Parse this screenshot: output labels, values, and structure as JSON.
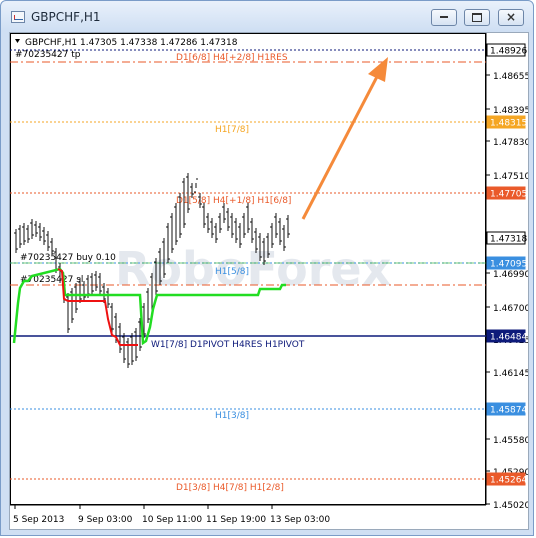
{
  "window": {
    "title": "GBPCHF,H1",
    "controls": [
      "minimize",
      "maximize",
      "close"
    ]
  },
  "chart_header": {
    "symbol_line": "GBPCHF,H1  1.47305 1.47338 1.47286 1.47318",
    "order_tp": "#70235427 tp",
    "order_buy": "#70235427 buy 0.10",
    "order_sl": "#70235427 sl"
  },
  "price_axis": {
    "ticks": [
      "1.48655",
      "1.48395",
      "1.47830",
      "1.47510",
      "1.46990",
      "1.46700",
      "1.46425",
      "1.46145",
      "1.45580",
      "1.45290",
      "1.45020"
    ],
    "tags": [
      {
        "label": "1.48926",
        "color": "#ffffff",
        "fg": "#000000"
      },
      {
        "label": "1.48315",
        "color": "#f5a623",
        "fg": "#ffffff"
      },
      {
        "label": "1.47705",
        "color": "#ea5a2a",
        "fg": "#ffffff"
      },
      {
        "label": "1.47318",
        "color": "#ffffff",
        "fg": "#000000"
      },
      {
        "label": "1.47095",
        "color": "#3a8fe0",
        "fg": "#ffffff"
      },
      {
        "label": "1.46484",
        "color": "#0d1a7a",
        "fg": "#ffffff"
      },
      {
        "label": "1.45874",
        "color": "#3a8fe0",
        "fg": "#ffffff"
      },
      {
        "label": "1.45264",
        "color": "#ea5a2a",
        "fg": "#ffffff"
      }
    ]
  },
  "time_axis": {
    "ticks": [
      "5 Sep 2013",
      "9 Sep 03:00",
      "10 Sep 11:00",
      "11 Sep 19:00",
      "13 Sep 03:00"
    ]
  },
  "levels": {
    "top": "D1[6/8] H4[+2/8] H1RES",
    "h1_78": "H1[7/8]",
    "mid_upper": "D1[5/8] H4[+1/8] H1[6/8]",
    "h1_58": "H1[5/8]",
    "pivot": "W1[7/8] D1PIVOT H4RES H1PIVOT",
    "h1_38": "H1[3/8]",
    "bottom": "D1[3/8] H4[7/8] H1[2/8]"
  },
  "watermark": "RoboForex",
  "colors": {
    "orange": "#f5a623",
    "red": "#ea5a2a",
    "blue": "#3a8fe0",
    "navy": "#0d1a7a",
    "green": "#22dd22",
    "arrow": "#f58a3a"
  }
}
